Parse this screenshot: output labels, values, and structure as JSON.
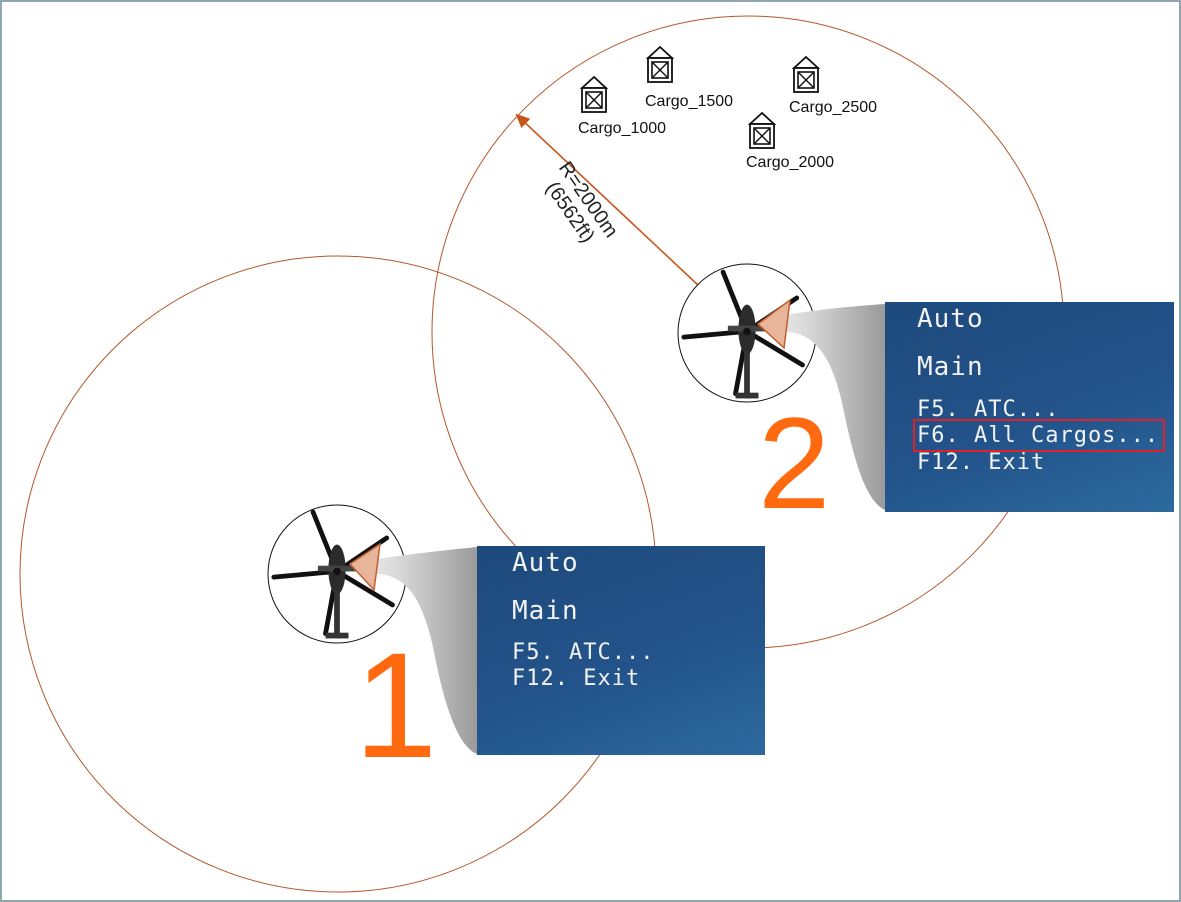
{
  "colors": {
    "range_circle": "#b5572a",
    "radius_arrow": "#c8561b",
    "step_number": "#ff6a10",
    "menu_bg": "#1f4c80",
    "menu_text": "#f2f2f2",
    "highlight_box": "#e0202a",
    "frame_border": "#8fa6aa"
  },
  "radius": {
    "line1": "R=2000m",
    "line2": "(6562ft)"
  },
  "cargos": [
    {
      "label": "Cargo_1000",
      "icon": "cargo-crate-icon"
    },
    {
      "label": "Cargo_1500",
      "icon": "cargo-crate-icon"
    },
    {
      "label": "Cargo_2500",
      "icon": "cargo-crate-icon"
    },
    {
      "label": "Cargo_2000",
      "icon": "cargo-crate-icon"
    }
  ],
  "panel1": {
    "step": "1",
    "title_auto": "Auto",
    "title_main": "Main",
    "items": [
      "F5. ATC...",
      "F12. Exit"
    ]
  },
  "panel2": {
    "step": "2",
    "title_auto": "Auto",
    "title_main": "Main",
    "items": [
      "F5. ATC...",
      "F6. All Cargos...",
      "F12. Exit"
    ],
    "highlighted_item": "F6. All Cargos..."
  }
}
